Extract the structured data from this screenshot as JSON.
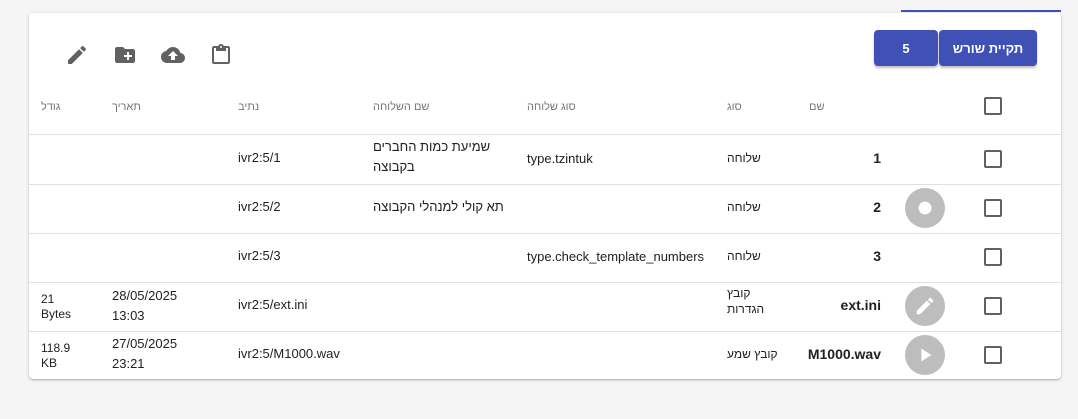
{
  "toolbar": {
    "root_folder_label": "תקיית שורש",
    "count_label": "5"
  },
  "icons": {
    "edit": "edit-icon",
    "new_folder": "create-new-folder-icon",
    "upload": "cloud-upload-icon",
    "paste": "clipboard-icon"
  },
  "table": {
    "headers": {
      "name": "שם",
      "type": "סוג",
      "ext_type": "סוג שלוחה",
      "ext_name": "שם השלוחה",
      "path": "נתיב",
      "date": "תאריך",
      "size": "גודל"
    },
    "rows": [
      {
        "name": "1",
        "type": "שלוחה",
        "ext_type": "type.tzintuk",
        "ext_name_line1": "שמיעת כמות החברים",
        "ext_name_line2": "בקבוצה",
        "path": "ivr2:5/1",
        "date_line1": "",
        "date_line2": "",
        "size_line1": "",
        "size_line2": "",
        "action": ""
      },
      {
        "name": "2",
        "type": "שלוחה",
        "ext_type": "",
        "ext_name_line1": "תא קולי למנהלי הקבוצה",
        "ext_name_line2": "",
        "path": "ivr2:5/2",
        "date_line1": "",
        "date_line2": "",
        "size_line1": "",
        "size_line2": "",
        "action": "record-icon"
      },
      {
        "name": "3",
        "type": "שלוחה",
        "ext_type": "type.check_template_numbers",
        "ext_name_line1": "",
        "ext_name_line2": "",
        "path": "ivr2:5/3",
        "date_line1": "",
        "date_line2": "",
        "size_line1": "",
        "size_line2": "",
        "action": ""
      },
      {
        "name": "ext.ini",
        "type_line1": "קובץ",
        "type_line2": "הגדרות",
        "ext_type": "",
        "ext_name_line1": "",
        "ext_name_line2": "",
        "path": "ivr2:5/ext.ini",
        "date_line1": "28/05/2025",
        "date_line2": "13:03",
        "size_line1": "21",
        "size_line2": "Bytes",
        "action": "edit-icon"
      },
      {
        "name": "M1000.wav",
        "type": "קובץ שמע",
        "ext_type": "",
        "ext_name_line1": "",
        "ext_name_line2": "",
        "path": "ivr2:5/M1000.wav",
        "date_line1": "27/05/2025",
        "date_line2": "23:21",
        "size_line1": "118.9",
        "size_line2": "KB",
        "action": "play-icon"
      }
    ]
  },
  "colors": {
    "primary": "#3f51b5",
    "action_circle": "#bdbdbd"
  }
}
